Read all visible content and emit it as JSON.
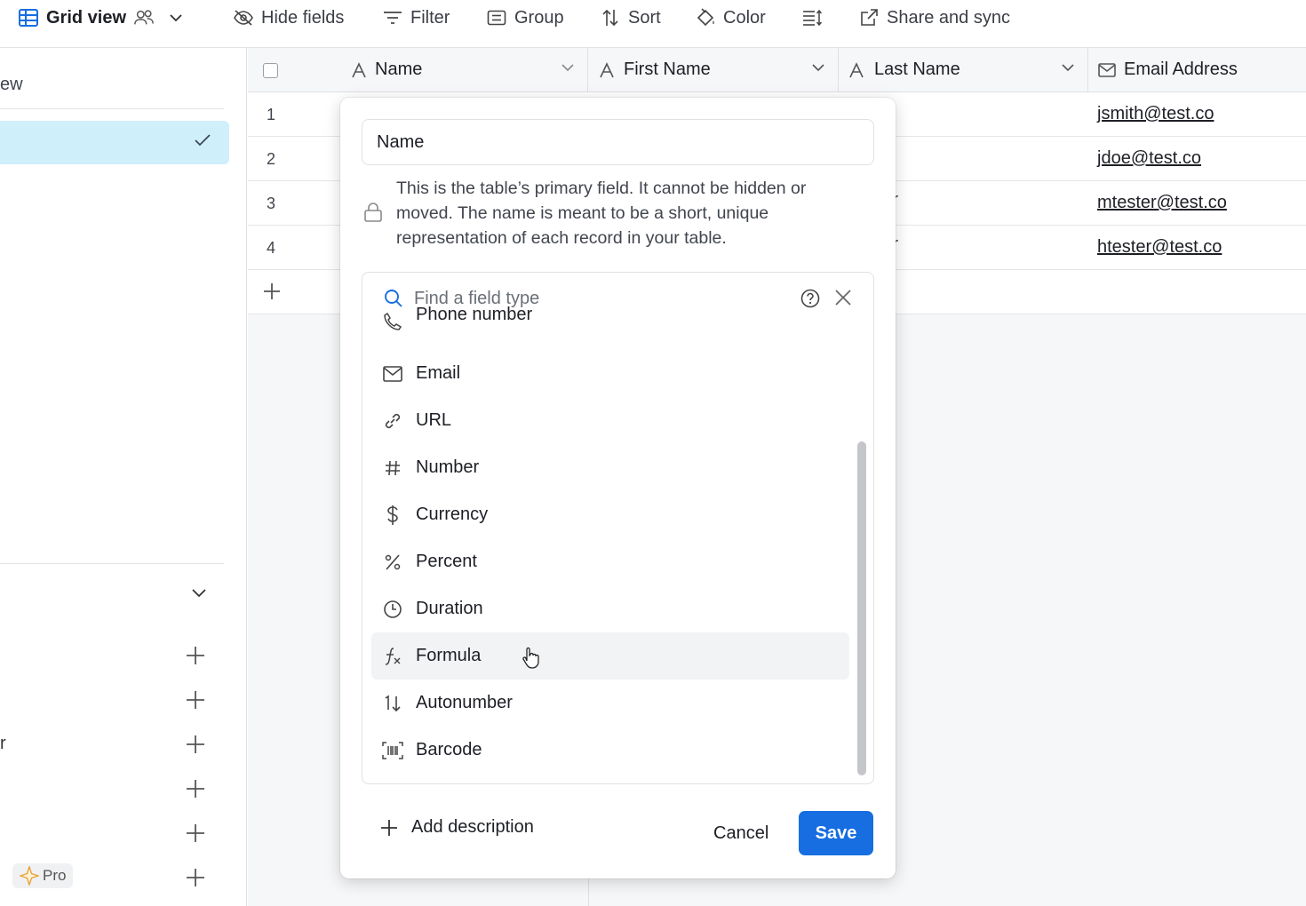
{
  "toolbar": {
    "view_name": "Grid view",
    "hide_fields": "Hide fields",
    "filter": "Filter",
    "group": "Group",
    "sort": "Sort",
    "color": "Color",
    "share": "Share and sync"
  },
  "sidebar": {
    "partial_label": "ew",
    "partial_item": "r",
    "pro_badge": "Pro"
  },
  "grid": {
    "columns": [
      "Name",
      "First Name",
      "Last Name",
      "Email Address"
    ],
    "rows": [
      {
        "num": "1",
        "email": "jsmith@test.co",
        "frag": ""
      },
      {
        "num": "2",
        "email": "jdoe@test.co",
        "frag": ""
      },
      {
        "num": "3",
        "email": "mtester@test.co",
        "frag": "r"
      },
      {
        "num": "4",
        "email": "htester@test.co",
        "frag": "r"
      }
    ]
  },
  "dialog": {
    "field_name": "Name",
    "primary_note": "This is the table’s primary field. It cannot be hidden or moved. The name is meant to be a short, unique representation of each record in your table.",
    "search_placeholder": "Find a field type",
    "field_types": [
      {
        "label": "Phone number",
        "icon": "phone-icon"
      },
      {
        "label": "Email",
        "icon": "envelope-icon"
      },
      {
        "label": "URL",
        "icon": "link-icon"
      },
      {
        "label": "Number",
        "icon": "hash-icon"
      },
      {
        "label": "Currency",
        "icon": "dollar-icon"
      },
      {
        "label": "Percent",
        "icon": "percent-icon"
      },
      {
        "label": "Duration",
        "icon": "clock-icon"
      },
      {
        "label": "Formula",
        "icon": "formula-icon"
      },
      {
        "label": "Autonumber",
        "icon": "autonumber-icon"
      },
      {
        "label": "Barcode",
        "icon": "barcode-icon"
      }
    ],
    "active_type": "Formula",
    "add_description": "Add description",
    "cancel": "Cancel",
    "save": "Save"
  },
  "colors": {
    "accent": "#166ee1",
    "selected_bg": "#cfeffb",
    "hover_bg": "#f2f3f5"
  }
}
